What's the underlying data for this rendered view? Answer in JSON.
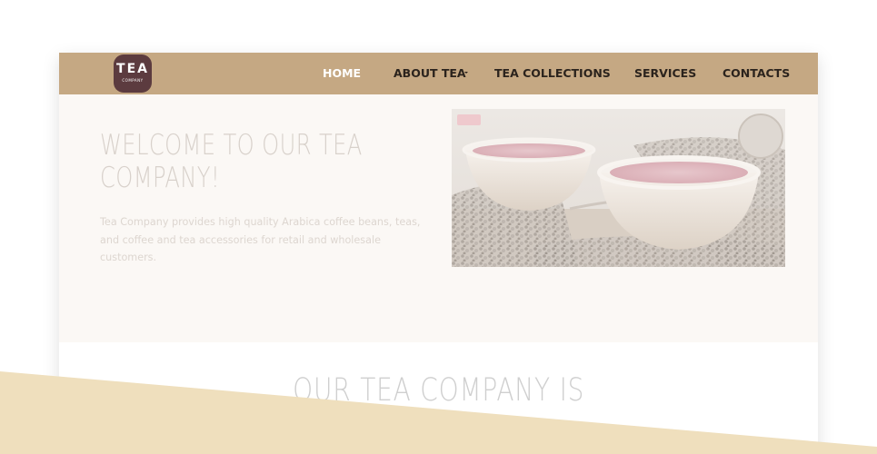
{
  "logo": {
    "main": "TEA",
    "sub": "COMPANY",
    "icon": "tea-company-logo",
    "color": "#5c3b3f"
  },
  "nav": {
    "background": "#c5a883",
    "items": [
      {
        "label": "HOME",
        "active": true
      },
      {
        "label": "ABOUT TEA",
        "has_dropdown": true
      },
      {
        "label": "TEA COLLECTIONS"
      },
      {
        "label": "SERVICES"
      },
      {
        "label": "CONTACTS"
      }
    ]
  },
  "hero": {
    "title": "WELCOME TO OUR TEA COMPANY!",
    "text": "Tea Company provides high quality Arabica coffee beans, teas, and coffee and tea accessories for retail and wholesale customers.",
    "image": "tea-cups-photo"
  },
  "section": {
    "title": "OUR TEA COMPANY IS"
  },
  "colors": {
    "wedge": "#efdfbd",
    "hero_background": "#fbf8f5"
  }
}
